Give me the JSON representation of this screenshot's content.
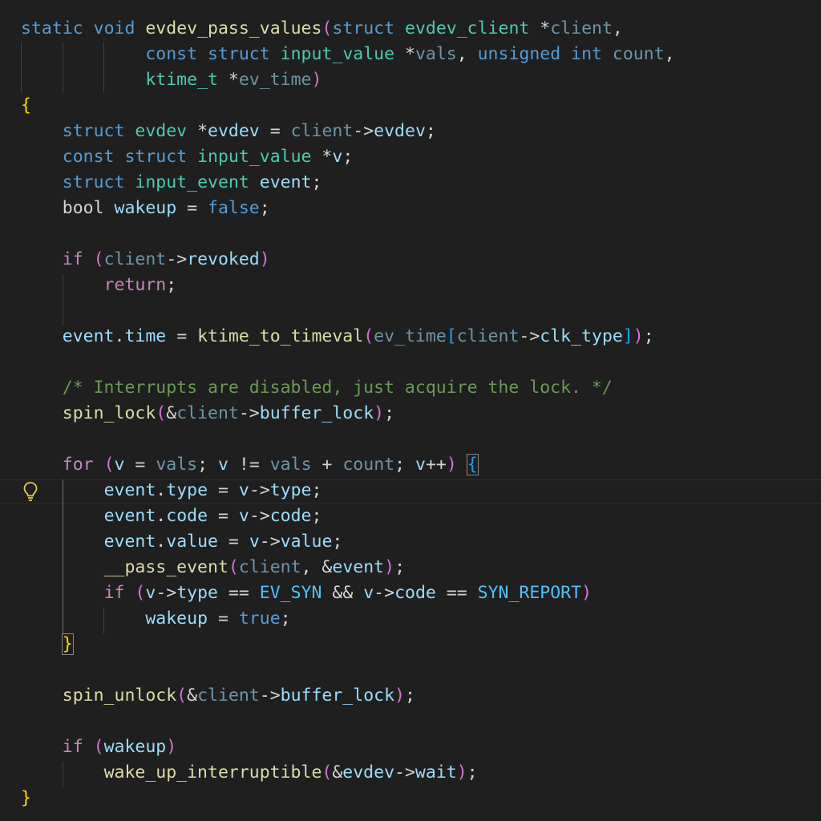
{
  "editor": {
    "theme_colors": {
      "background": "#1f1f1f",
      "keyword": "#569cd6",
      "control": "#c586c0",
      "type": "#4ec9b0",
      "function": "#dcdcaa",
      "variable": "#9cdcfe",
      "comment": "#6a9955",
      "constant": "#4fc1ff",
      "bracket_level1": "#ffd700",
      "bracket_level2": "#da70d6",
      "bracket_level3": "#179fff"
    },
    "gutter_icon": "lightbulb-icon",
    "code": {
      "l1": {
        "static": "static",
        "void": "void",
        "fname": "evdev_pass_values",
        "p1": "(",
        "struct1": "struct",
        "ty1": "evdev_client",
        "star1": " *",
        "client": "client",
        "comma1": ","
      },
      "l2": {
        "const": "const",
        "struct": "struct",
        "ty": "input_value",
        "star": " *",
        "vals": "vals",
        "comma": ", ",
        "unsigned": "unsigned",
        "int": "int",
        "count": "count",
        "comma2": ","
      },
      "l3": {
        "ty": "ktime_t",
        "star": " *",
        "ev_time": "ev_time",
        "p1c": ")"
      },
      "l4": {
        "brace": "{"
      },
      "l5": {
        "struct": "struct",
        "ty": "evdev",
        "star": " *",
        "evdev": "evdev",
        "eq": " = ",
        "client": "client",
        "arrow": "->",
        "member": "evdev",
        "semi": ";"
      },
      "l6": {
        "const": "const",
        "struct": "struct",
        "ty": "input_value",
        "star": " *",
        "v": "v",
        "semi": ";"
      },
      "l7": {
        "struct": "struct",
        "ty": "input_event",
        "event": "event",
        "semi": ";"
      },
      "l8": {
        "bool": "bool",
        "wakeup": "wakeup",
        "eq": " = ",
        "false": "false",
        "semi": ";"
      },
      "l10": {
        "if": "if",
        "p": "(",
        "client": "client",
        "arrow": "->",
        "revoked": "revoked",
        "pc": ")"
      },
      "l11": {
        "return": "return",
        "semi": ";"
      },
      "l13": {
        "event": "event",
        "dot": ".",
        "time": "time",
        "eq": " = ",
        "fn": "ktime_to_timeval",
        "p": "(",
        "ev_time": "ev_time",
        "b": "[",
        "client": "client",
        "arrow": "->",
        "clk_type": "clk_type",
        "bc": "]",
        "pc": ")",
        "semi": ";"
      },
      "l15": {
        "comment": "/* Interrupts are disabled, just acquire the lock. */"
      },
      "l16": {
        "fn": "spin_lock",
        "p": "(",
        "amp": "&",
        "client": "client",
        "arrow": "->",
        "member": "buffer_lock",
        "pc": ")",
        "semi": ";"
      },
      "l18": {
        "for": "for",
        "p": "(",
        "v": "v",
        "eq": " = ",
        "vals": "vals",
        "semi1": "; ",
        "v2": "v",
        "ne": " != ",
        "vals2": "vals",
        "plus": " + ",
        "count": "count",
        "semi2": "; ",
        "v3": "v",
        "inc": "++",
        "pc": ")",
        "brace": "{"
      },
      "l19": {
        "event": "event",
        "dot": ".",
        "field": "type",
        "eq": " = ",
        "v": "v",
        "arrow": "->",
        "member": "type",
        "semi": ";"
      },
      "l20": {
        "event": "event",
        "dot": ".",
        "field": "code",
        "eq": " = ",
        "v": "v",
        "arrow": "->",
        "member": "code",
        "semi": ";"
      },
      "l21": {
        "event": "event",
        "dot": ".",
        "field": "value",
        "eq": " = ",
        "v": "v",
        "arrow": "->",
        "member": "value",
        "semi": ";"
      },
      "l22": {
        "fn": "__pass_event",
        "p": "(",
        "client": "client",
        "comma": ", ",
        "amp": "&",
        "event": "event",
        "pc": ")",
        "semi": ";"
      },
      "l23": {
        "if": "if",
        "p": "(",
        "v": "v",
        "arrow": "->",
        "type": "type",
        "eqeq": " == ",
        "evsyn": "EV_SYN",
        "and": " && ",
        "v2": "v",
        "arrow2": "->",
        "code": "code",
        "eqeq2": " == ",
        "synreport": "SYN_REPORT",
        "pc": ")"
      },
      "l24": {
        "wakeup": "wakeup",
        "eq": " = ",
        "true": "true",
        "semi": ";"
      },
      "l25": {
        "brace": "}"
      },
      "l27": {
        "fn": "spin_unlock",
        "p": "(",
        "amp": "&",
        "client": "client",
        "arrow": "->",
        "member": "buffer_lock",
        "pc": ")",
        "semi": ";"
      },
      "l29": {
        "if": "if",
        "p": "(",
        "wakeup": "wakeup",
        "pc": ")"
      },
      "l30": {
        "fn": "wake_up_interruptible",
        "p": "(",
        "amp": "&",
        "evdev": "evdev",
        "arrow": "->",
        "member": "wait",
        "pc": ")",
        "semi": ";"
      },
      "l31": {
        "brace": "}"
      }
    }
  }
}
